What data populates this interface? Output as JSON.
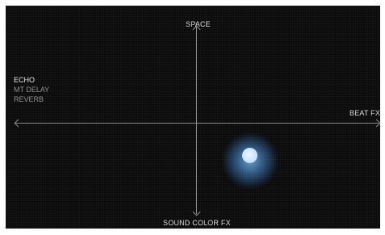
{
  "axes": {
    "top_label": "SPACE",
    "bottom_label": "SOUND COLOR FX",
    "right_label": "BEAT FX"
  },
  "fx_list": [
    {
      "label": "ECHO",
      "active": true
    },
    {
      "label": "MT DELAY",
      "active": false
    },
    {
      "label": "REVERB",
      "active": false
    }
  ],
  "colors": {
    "background": "#0b0b0b",
    "axis": "#8a8a8a",
    "touch_glow": "#4a8fd2",
    "touch_core": "#d8ebff"
  }
}
